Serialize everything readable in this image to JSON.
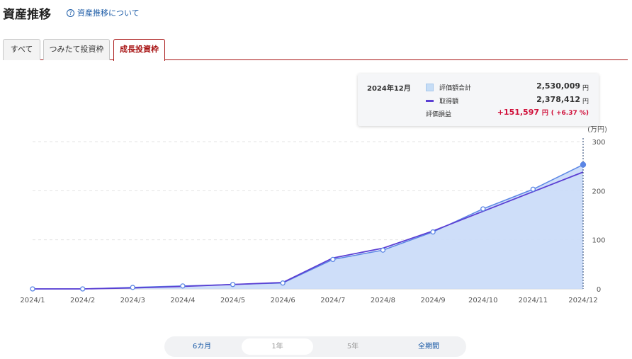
{
  "header": {
    "title": "資産推移",
    "help_link": "資産推移について"
  },
  "tabs": [
    {
      "label": "すべて",
      "active": false
    },
    {
      "label": "つみたて投資枠",
      "active": false
    },
    {
      "label": "成長投資枠",
      "active": true
    }
  ],
  "tooltip": {
    "period": "2024年12月",
    "valuation_label": "評価額合計",
    "valuation_value": "2,530,009",
    "cost_label": "取得額",
    "cost_value": "2,378,412",
    "gain_label": "評価損益",
    "gain_value": "+151,597",
    "gain_pct": "( +6.37 %)",
    "unit": "円"
  },
  "chart_data": {
    "type": "area",
    "x": [
      "2024/1",
      "2024/2",
      "2024/3",
      "2024/4",
      "2024/5",
      "2024/6",
      "2024/7",
      "2024/8",
      "2024/9",
      "2024/10",
      "2024/11",
      "2024/12"
    ],
    "series": [
      {
        "name": "評価額合計",
        "kind": "area",
        "color": "#5b86e5",
        "fill": "#c9daf8",
        "values": [
          0,
          0,
          3,
          6,
          9,
          12,
          60,
          79,
          116,
          163,
          203,
          253
        ]
      },
      {
        "name": "取得額",
        "kind": "line",
        "color": "#5b3fd3",
        "values": [
          0,
          0,
          2,
          5,
          9,
          13,
          63,
          83,
          118,
          158,
          198,
          238
        ]
      }
    ],
    "yticks": [
      0,
      100,
      200,
      300
    ],
    "ylim": [
      0,
      300
    ],
    "yunit": "(万円)",
    "y_axis_position": "right",
    "grid": "horizontal dashed",
    "highlight_index": 11
  },
  "range_selector": [
    {
      "label": "6カ月",
      "state": "enabled"
    },
    {
      "label": "1年",
      "state": "selected"
    },
    {
      "label": "5年",
      "state": "disabled"
    },
    {
      "label": "全期間",
      "state": "enabled"
    }
  ]
}
